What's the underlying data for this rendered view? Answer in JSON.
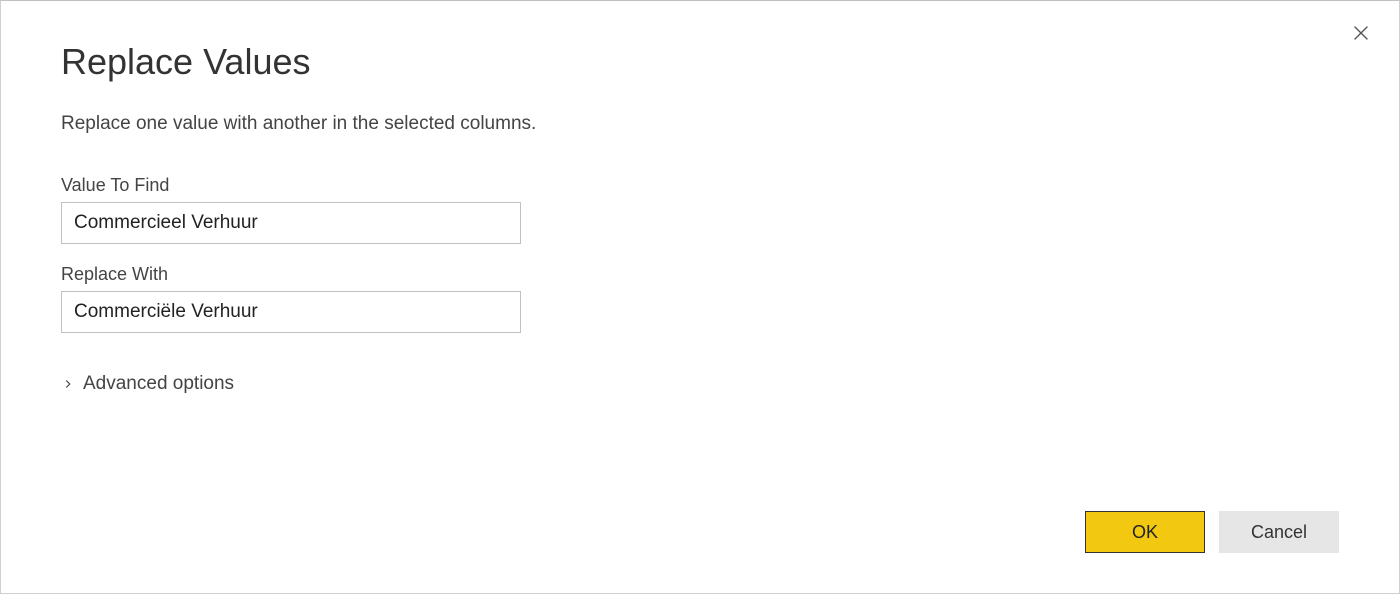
{
  "dialog": {
    "title": "Replace Values",
    "description": "Replace one value with another in the selected columns.",
    "close_icon": "close"
  },
  "fields": {
    "value_to_find": {
      "label": "Value To Find",
      "value": "Commercieel Verhuur"
    },
    "replace_with": {
      "label": "Replace With",
      "value": "Commerciële Verhuur"
    }
  },
  "advanced": {
    "label": "Advanced options"
  },
  "buttons": {
    "ok_label": "OK",
    "cancel_label": "Cancel"
  }
}
